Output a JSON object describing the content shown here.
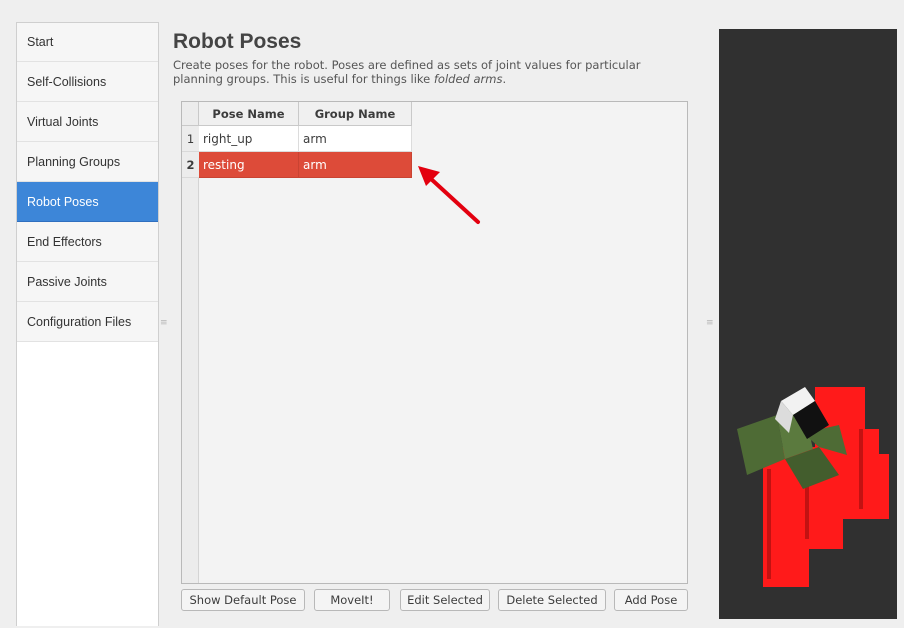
{
  "sidebar": {
    "items": [
      {
        "label": "Start"
      },
      {
        "label": "Self-Collisions"
      },
      {
        "label": "Virtual Joints"
      },
      {
        "label": "Planning Groups"
      },
      {
        "label": "Robot Poses",
        "active": true
      },
      {
        "label": "End Effectors"
      },
      {
        "label": "Passive Joints"
      },
      {
        "label": "Configuration Files"
      }
    ]
  },
  "main": {
    "title": "Robot Poses",
    "description_line1": "Create poses for the robot. Poses are defined as sets of joint values for particular",
    "description_line2_prefix": "planning groups. This is useful for things like ",
    "description_line2_emphasis": "folded arms",
    "description_line2_suffix": "."
  },
  "table": {
    "columns": [
      "Pose Name",
      "Group Name"
    ],
    "rows": [
      {
        "num": "1",
        "pose": "right_up",
        "group": "arm",
        "selected": false
      },
      {
        "num": "2",
        "pose": "resting",
        "group": "arm",
        "selected": true
      }
    ]
  },
  "buttons": {
    "show_default": "Show Default Pose",
    "moveit": "MoveIt!",
    "edit": "Edit Selected",
    "delete": "Delete Selected",
    "add": "Add Pose"
  },
  "splitter_glyph": "≡",
  "colors": {
    "accent_nav": "#3d86d8",
    "selection": "#dd4b39",
    "annotation_arrow": "#e3000f",
    "viewer_bg": "#303030",
    "robot_red": "#ff1a1a",
    "robot_green": "#4e6b35"
  }
}
